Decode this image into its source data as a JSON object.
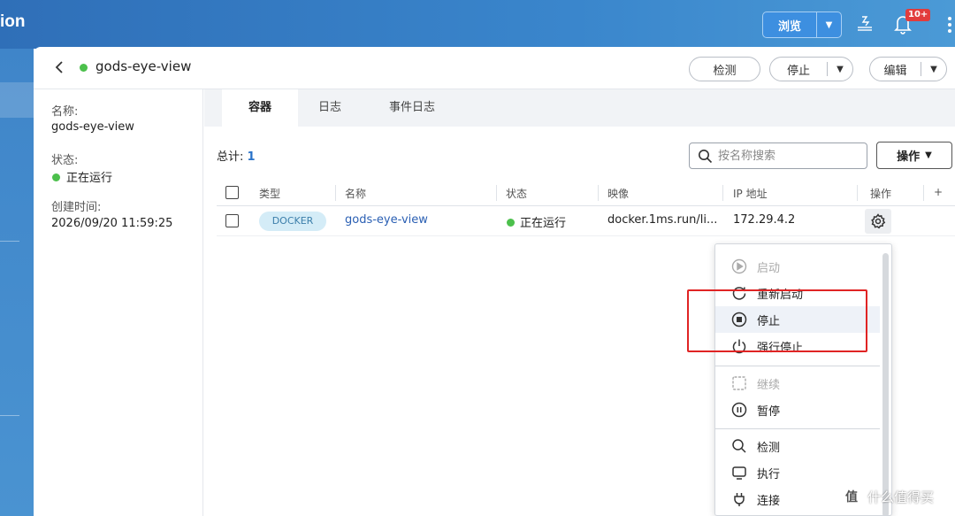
{
  "app": {
    "title_fragment": "ion"
  },
  "topbar": {
    "browse_label": "浏览",
    "notification_badge": "10+"
  },
  "container": {
    "name": "gods-eye-view",
    "status_color": "#4cc04c"
  },
  "header_actions": {
    "detect_label": "检测",
    "stop_label": "停止",
    "edit_label": "编辑"
  },
  "info": {
    "name_label": "名称:",
    "name_value": "gods-eye-view",
    "status_label": "状态:",
    "status_value": "正在运行",
    "created_label": "创建时间:",
    "created_value": "2026/09/20 11:59:25"
  },
  "tabs": [
    {
      "label": "容器",
      "active": true
    },
    {
      "label": "日志",
      "active": false
    },
    {
      "label": "事件日志",
      "active": false
    }
  ],
  "toolbar": {
    "total_label": "总计:",
    "total_value": "1",
    "search_placeholder": "按名称搜索",
    "operations_label": "操作"
  },
  "table": {
    "headers": [
      "类型",
      "名称",
      "状态",
      "映像",
      "IP 地址",
      "操作",
      "+"
    ],
    "rows": [
      {
        "type": "DOCKER",
        "name": "gods-eye-view",
        "status": "正在运行",
        "image": "docker.1ms.run/li...",
        "ip": "172.29.4.2"
      }
    ]
  },
  "menu": {
    "items": [
      {
        "label": "启动",
        "icon": "play-circle-icon",
        "disabled": true
      },
      {
        "label": "重新启动",
        "icon": "restart-icon",
        "disabled": false
      },
      {
        "label": "停止",
        "icon": "stop-circle-icon",
        "disabled": false,
        "hover": true
      },
      {
        "label": "强行停止",
        "icon": "power-icon",
        "disabled": false
      },
      {
        "label": "继续",
        "icon": "resume-icon",
        "disabled": true
      },
      {
        "label": "暂停",
        "icon": "pause-circle-icon",
        "disabled": false
      },
      {
        "label": "检测",
        "icon": "search-icon",
        "disabled": false
      },
      {
        "label": "执行",
        "icon": "terminal-icon",
        "disabled": false
      },
      {
        "label": "连接",
        "icon": "plug-icon",
        "disabled": false
      }
    ]
  },
  "annotation": {
    "color": "#e02424"
  },
  "watermark": {
    "text": "什么值得买",
    "logo": "值"
  },
  "colors": {
    "topbar": "#3a86cc",
    "accent": "#2a73c9",
    "running": "#4cc04c",
    "badge": "#e23c3c"
  }
}
